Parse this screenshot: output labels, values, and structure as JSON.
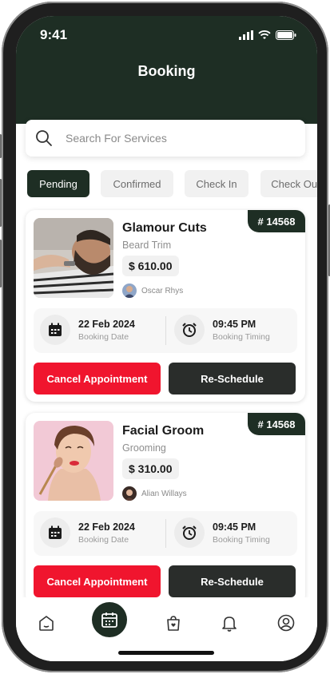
{
  "status_bar": {
    "time": "9:41"
  },
  "header": {
    "title": "Booking"
  },
  "search": {
    "placeholder": "Search For Services"
  },
  "tabs": [
    {
      "label": "Pending",
      "active": true
    },
    {
      "label": "Confirmed",
      "active": false
    },
    {
      "label": "Check In",
      "active": false
    },
    {
      "label": "Check Out",
      "active": false
    }
  ],
  "bookings": [
    {
      "id": "# 14568",
      "salon": "Glamour Cuts",
      "service": "Beard Trim",
      "price": "$ 610.00",
      "stylist": "Oscar Rhys",
      "date": "22 Feb 2024",
      "date_label": "Booking Date",
      "time": "09:45 PM",
      "time_label": "Booking Timing",
      "cancel_label": "Cancel Appointment",
      "reschedule_label": "Re-Schedule"
    },
    {
      "id": "# 14568",
      "salon": "Facial Groom",
      "service": "Grooming",
      "price": "$ 310.00",
      "stylist": "Alian Willays",
      "date": "22 Feb 2024",
      "date_label": "Booking Date",
      "time": "09:45 PM",
      "time_label": "Booking Timing",
      "cancel_label": "Cancel Appointment",
      "reschedule_label": "Re-Schedule"
    }
  ],
  "bottom_nav": [
    "home-icon",
    "calendar-icon",
    "shopping-bag-icon",
    "bell-icon",
    "profile-icon"
  ],
  "colors": {
    "primary": "#1e2e24",
    "danger": "#f0152e",
    "dark_button": "#2a2d2b"
  }
}
